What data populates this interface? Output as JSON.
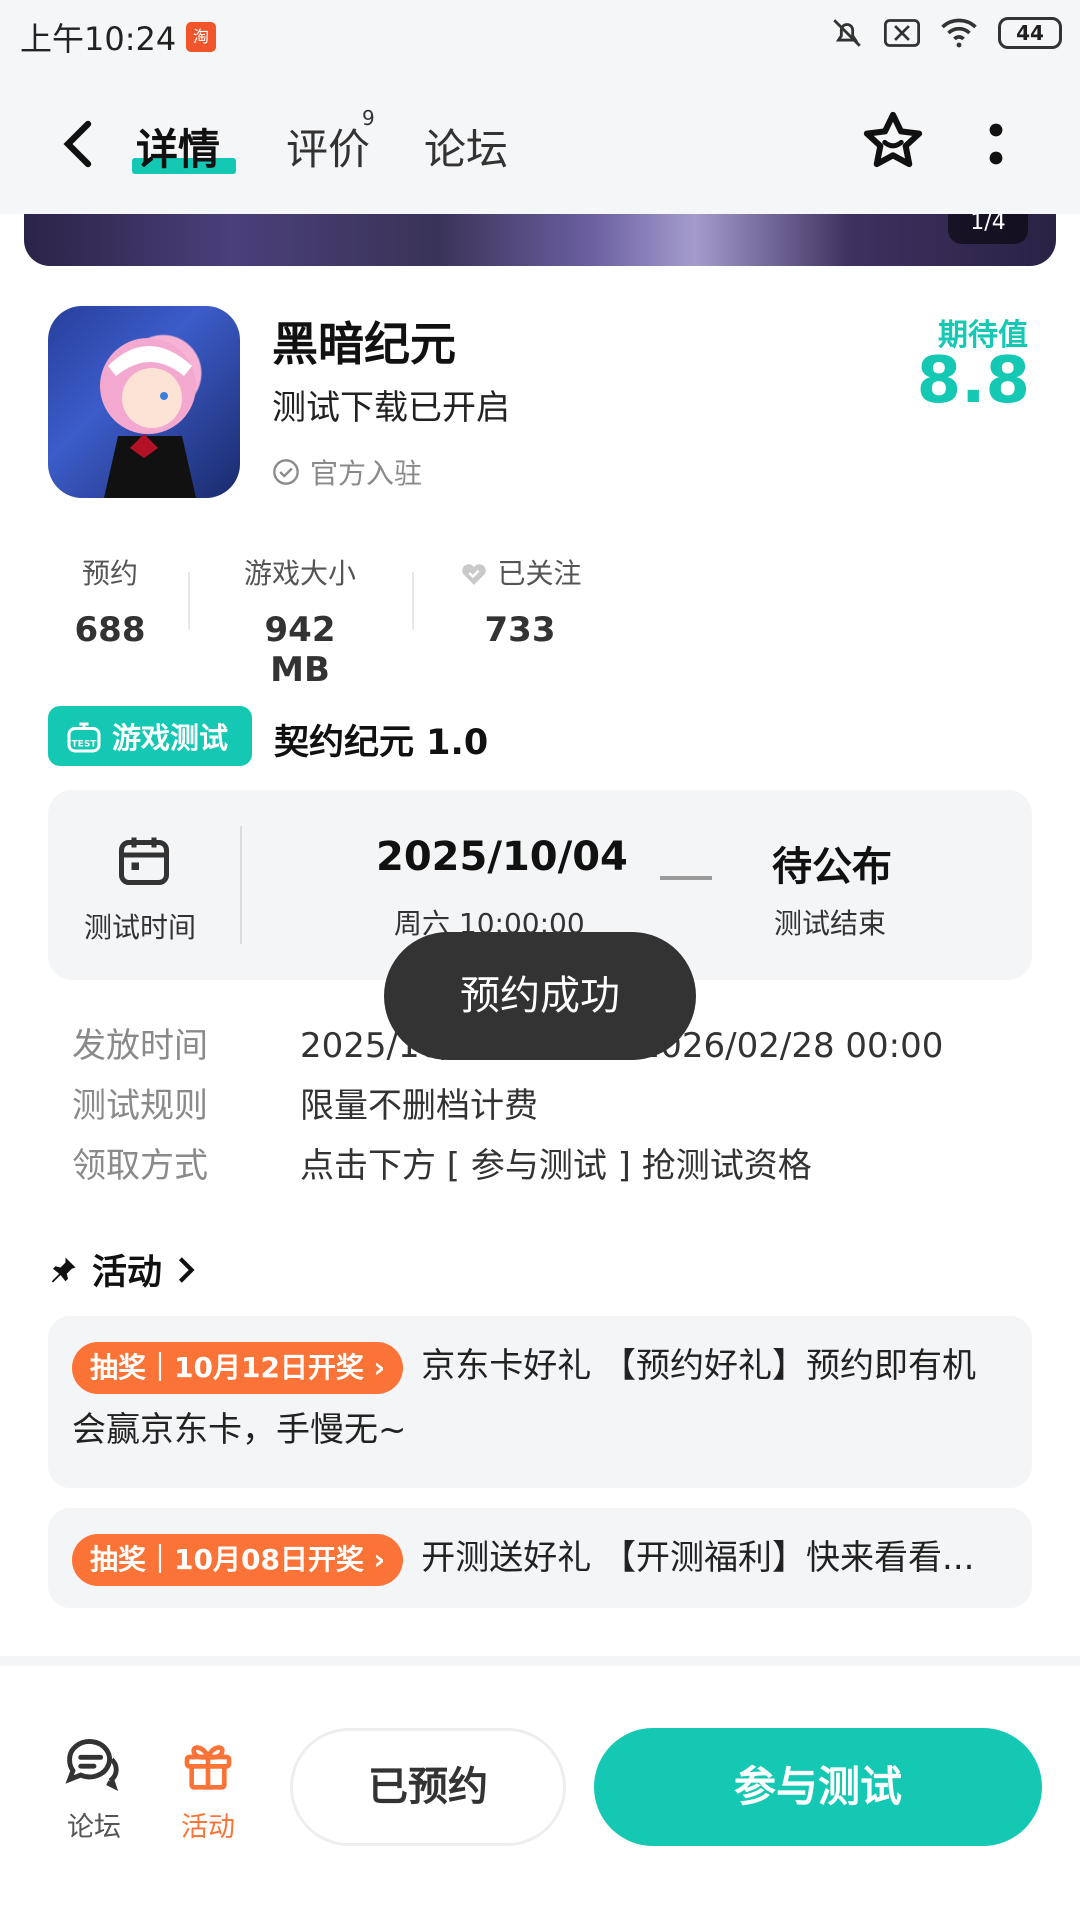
{
  "status_bar": {
    "time": "上午10:24",
    "notification_icon_text": "淘",
    "battery": "44"
  },
  "nav": {
    "tabs": [
      {
        "label": "详情"
      },
      {
        "label": "评价",
        "badge": "9"
      },
      {
        "label": "论坛"
      }
    ]
  },
  "banner": {
    "counter": "1/4"
  },
  "app": {
    "title": "黑暗纪元",
    "subtitle": "测试下载已开启",
    "official": "官方入驻",
    "expect_label": "期待值",
    "expect_score": "8.8"
  },
  "stats": [
    {
      "label": "预约",
      "value": "688"
    },
    {
      "label": "游戏大小",
      "value": "942 MB"
    },
    {
      "label": "已关注",
      "value": "733"
    }
  ],
  "test": {
    "badge": "游戏测试",
    "name": "契约纪元 1.0",
    "time_label": "测试时间",
    "start_date": "2025/10/04",
    "start_sub": "周六 10:00:00",
    "end_date": "待公布",
    "end_sub": "测试结束"
  },
  "info": [
    {
      "key": "发放时间",
      "value": "2025/10/04 10:00 - 2026/02/28 00:00"
    },
    {
      "key": "测试规则",
      "value": "限量不删档计费"
    },
    {
      "key": "领取方式",
      "value": "点击下方 [ 参与测试 ] 抢测试资格"
    }
  ],
  "toast": "预约成功",
  "activities": {
    "title": "活动",
    "items": [
      {
        "tag": "抽奖｜10月12日开奖 ›",
        "text": "京东卡好礼 【预约好礼】预约即有机会赢京东卡，手慢无~"
      },
      {
        "tag": "抽奖｜10月08日开奖 ›",
        "text": "开测送好礼 【开测福利】快来看看..."
      }
    ]
  },
  "bottom": {
    "forum": "论坛",
    "activity": "活动",
    "reserved": "已预约",
    "join": "参与测试"
  },
  "colors": {
    "accent": "#14c8b4",
    "orange": "#fb7336",
    "toast_bg": "#333333"
  }
}
